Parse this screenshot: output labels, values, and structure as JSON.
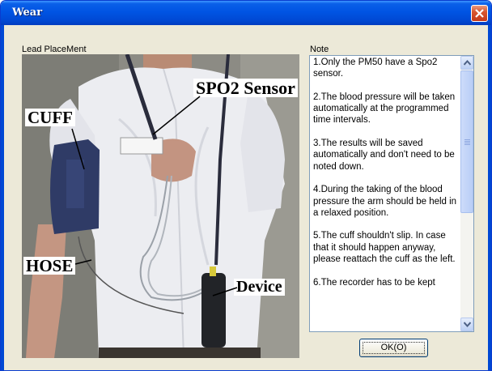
{
  "window": {
    "title": "Wear",
    "close_icon": "close-icon"
  },
  "lead_panel": {
    "label": "Lead PlaceMent",
    "annotations": {
      "spo2": "SPO2 Sensor",
      "cuff": "CUFF",
      "hose": "HOSE",
      "device": "Device"
    }
  },
  "note_panel": {
    "label": "Note",
    "items": [
      "1.Only the PM50 have a Spo2 sensor.",
      "2.The blood pressure will be taken automatically at the programmed time intervals.",
      "3.The results will be saved automatically and don't need to be noted down.",
      "4.During the taking of the blood pressure the arm should be held in a relaxed position.",
      "5.The cuff shouldn't slip. In case that it should happen anyway, please reattach the cuff as the left.",
      "6.The recorder has to be kept"
    ]
  },
  "buttons": {
    "ok": "OK(O)"
  },
  "colors": {
    "titlebar": "#0054e3",
    "close_button": "#d8562f",
    "dialog_background": "#ece9d8",
    "scrollbar_thumb": "#c3d3f7"
  }
}
